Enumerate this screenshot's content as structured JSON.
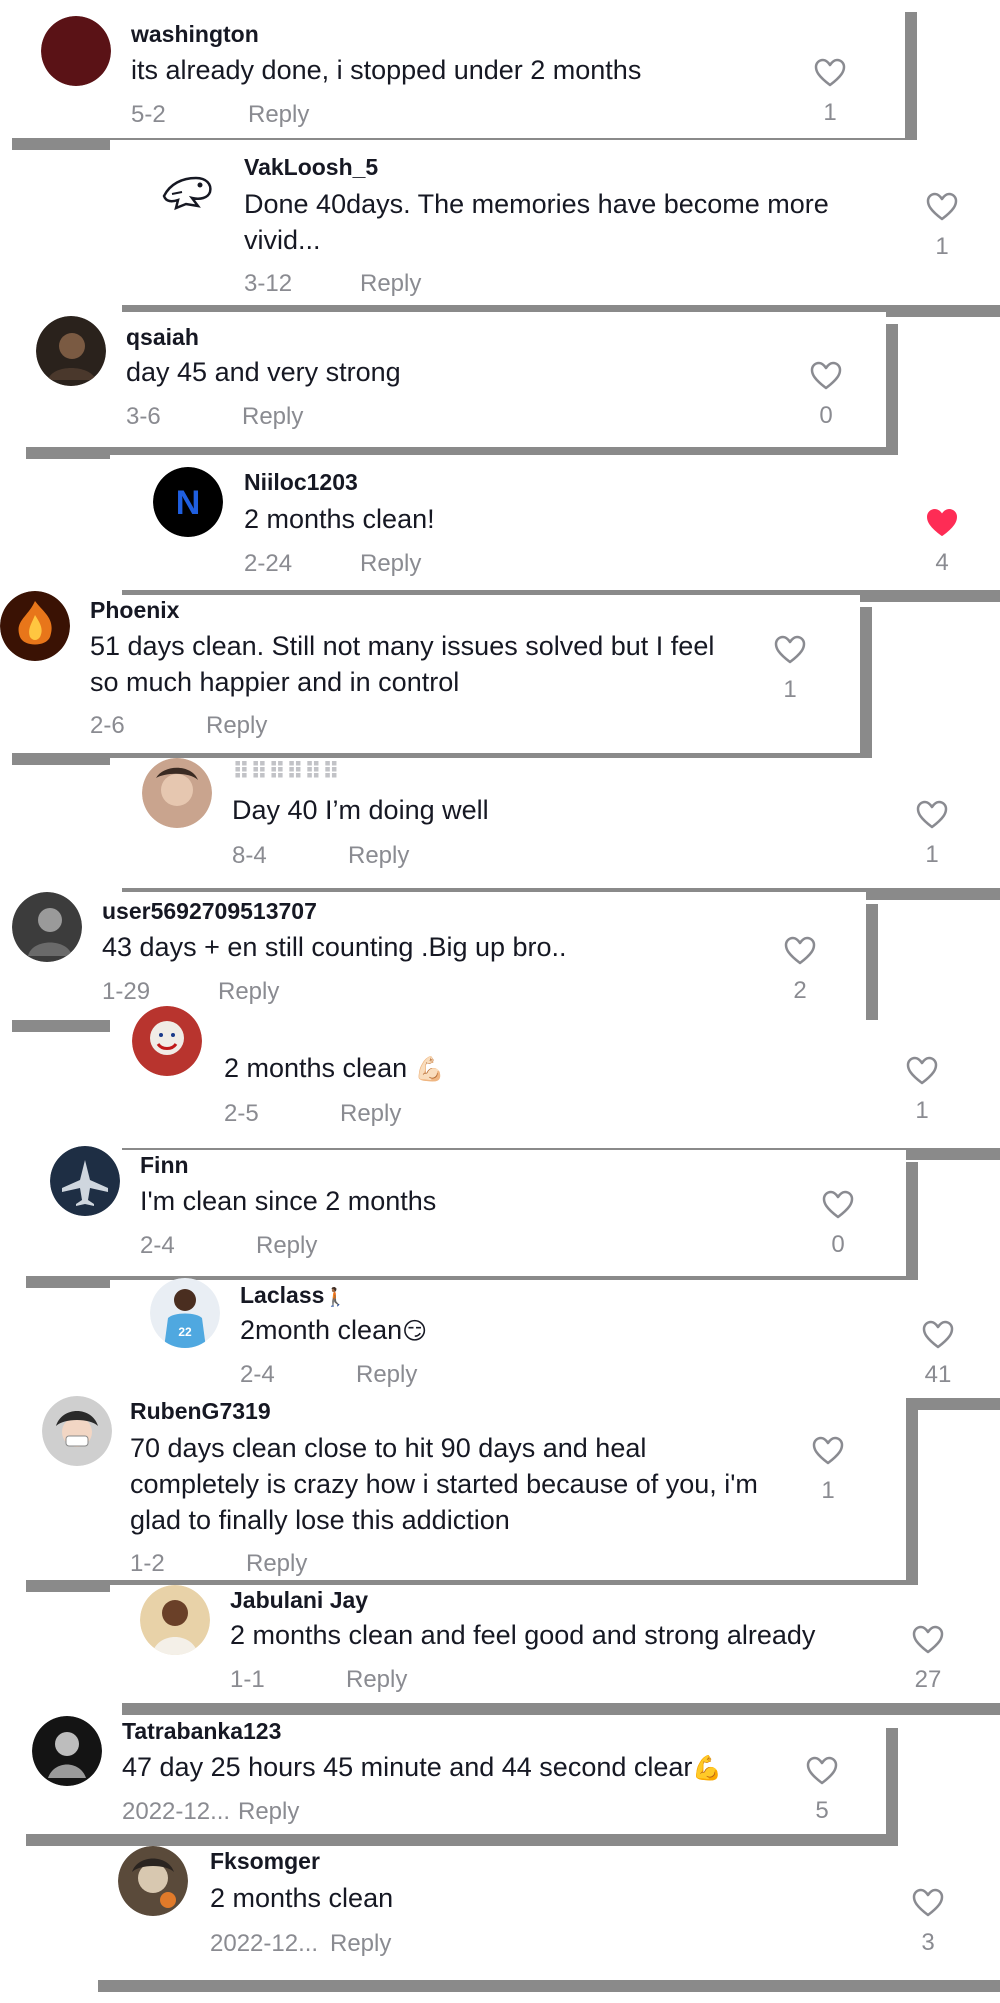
{
  "colors": {
    "shadow": "#8a8a8a",
    "text": "#161823",
    "muted": "#8a8b91",
    "liked": "#fe2c55"
  },
  "comments": [
    {
      "user": "washington",
      "text": "its already done, i stopped under 2 months",
      "date": "5-2",
      "reply": "Reply",
      "likes": "1",
      "liked": false,
      "avatar": "avatar-dark-red"
    },
    {
      "user": "VakLoosh_5",
      "text": "Done 40days. The memories have become more vivid...",
      "date": "3-12",
      "reply": "Reply",
      "likes": "1",
      "liked": false,
      "avatar": "frog-sketch-icon"
    },
    {
      "user": "qsaiah",
      "text": "day 45 and very strong",
      "date": "3-6",
      "reply": "Reply",
      "likes": "0",
      "liked": false,
      "avatar": "avatar-photo"
    },
    {
      "user": "Niiloc1203",
      "text": "2 months clean!",
      "date": "2-24",
      "reply": "Reply",
      "likes": "4",
      "liked": true,
      "avatar": "letter-n-avatar"
    },
    {
      "user": "Phoenix",
      "text": "51 days clean. Still not many issues solved but I feel so much happier and in control",
      "date": "2-6",
      "reply": "Reply",
      "likes": "1",
      "liked": false,
      "avatar": "phoenix-fire-avatar"
    },
    {
      "user": "⠿⠿⠿⠿⠿⠿",
      "text": "Day 40 I’m doing well",
      "date": "8-4",
      "reply": "Reply",
      "likes": "1",
      "liked": false,
      "avatar": "avatar-photo"
    },
    {
      "user": "user5692709513707",
      "text": "43 days + en still counting .Big up bro..",
      "date": "1-29",
      "reply": "Reply",
      "likes": "2",
      "liked": false,
      "avatar": "avatar-photo"
    },
    {
      "user": "",
      "text": "2 months clean",
      "emoji": "💪🏻",
      "date": "2-5",
      "reply": "Reply",
      "likes": "1",
      "liked": false,
      "avatar": "joker-avatar"
    },
    {
      "user": "Finn",
      "text": "I'm clean since 2 months",
      "date": "2-4",
      "reply": "Reply",
      "likes": "0",
      "liked": false,
      "avatar": "jet-avatar"
    },
    {
      "user": "Laclass",
      "user_emoji": "🚶🏾",
      "text": "2month clean",
      "emoji": "😏",
      "date": "2-4",
      "reply": "Reply",
      "likes": "41",
      "liked": false,
      "avatar": "player-avatar"
    },
    {
      "user": "RubenG7319",
      "text": "70 days clean close to hit 90 days and heal completely is crazy how i started because of you, i'm glad to finally lose this addiction",
      "date": "1-2",
      "reply": "Reply",
      "likes": "1",
      "liked": false,
      "avatar": "avatar-photo"
    },
    {
      "user": "Jabulani Jay",
      "text": "2 months clean and feel good and strong already",
      "date": "1-1",
      "reply": "Reply",
      "likes": "27",
      "liked": false,
      "avatar": "avatar-photo"
    },
    {
      "user": "Tatrabanka123",
      "text": "47 day 25 hours 45 minute and 44 second clear",
      "emoji": "💪",
      "date": "2022-12...",
      "reply": "Reply",
      "likes": "5",
      "liked": false,
      "avatar": "avatar-photo"
    },
    {
      "user": "Fksomger",
      "text": "2 months clean",
      "date": "2022-12...",
      "reply": "Reply",
      "likes": "3",
      "liked": false,
      "avatar": "avatar-photo"
    }
  ]
}
